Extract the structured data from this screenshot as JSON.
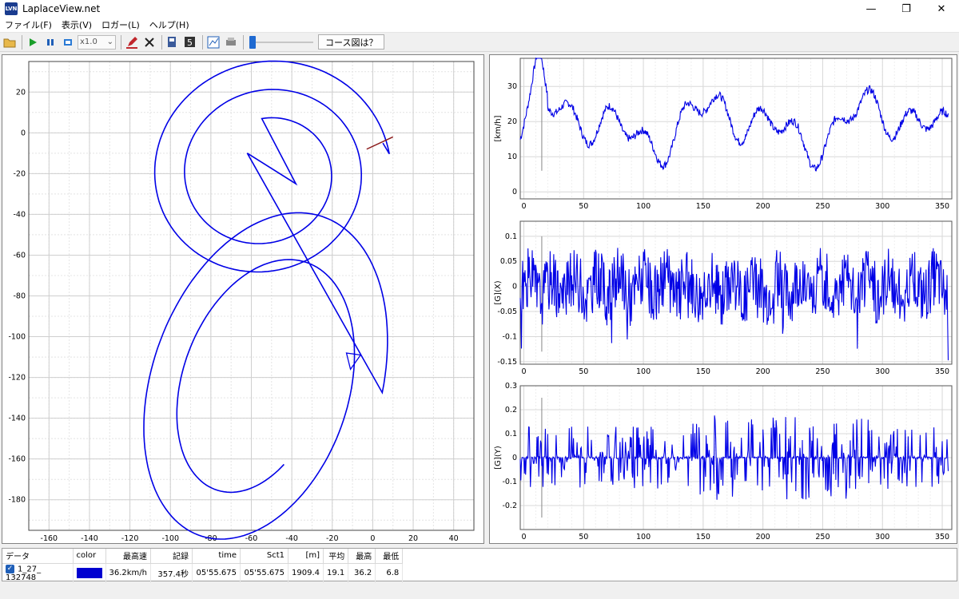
{
  "window": {
    "title": "LaplaceView.net",
    "icon": "LVN",
    "min": "—",
    "max": "❐",
    "close": "✕"
  },
  "menu": [
    "ファイル(F)",
    "表示(V)",
    "ロガー(L)",
    "ヘルプ(H)"
  ],
  "toolbar": {
    "speed": "x1.0",
    "course_button": "コース図は？",
    "slider_position": 0
  },
  "colors": {
    "trace": "#0000e6",
    "accent": "#1f6ad1",
    "marker": "#8b1a1a"
  },
  "track_plot": {
    "x_ticks": [
      "-160",
      "-140",
      "-120",
      "-100",
      "-80",
      "-60",
      "-40",
      "-20",
      "0",
      "20",
      "40"
    ],
    "y_ticks": [
      "20",
      "0",
      "-20",
      "-40",
      "-60",
      "-80",
      "-100",
      "-120",
      "-140",
      "-160",
      "-180"
    ]
  },
  "speed_chart": {
    "ylabel": "[km/h]",
    "y_ticks": [
      "0",
      "10",
      "20",
      "30"
    ],
    "x_ticks": [
      "0",
      "50",
      "100",
      "150",
      "200",
      "250",
      "300",
      "350"
    ]
  },
  "gx_chart": {
    "ylabel": "[G](X)",
    "y_ticks": [
      "-0.15",
      "-0.1",
      "-0.05",
      "0",
      "0.05",
      "0.1"
    ],
    "x_ticks": [
      "0",
      "50",
      "100",
      "150",
      "200",
      "250",
      "300",
      "350"
    ]
  },
  "gy_chart": {
    "ylabel": "[G](Y)",
    "y_ticks": [
      "-0.2",
      "-0.1",
      "0",
      "0.1",
      "0.2",
      "0.3"
    ],
    "x_ticks": [
      "0",
      "50",
      "100",
      "150",
      "200",
      "250",
      "300",
      "350"
    ]
  },
  "table": {
    "headers": [
      "データ",
      "color",
      "最高速",
      "記録",
      "time",
      "Sct1",
      "[m]",
      "平均",
      "最高",
      "最低"
    ],
    "row": {
      "checked": "✓",
      "name": "1_27_ 132748",
      "color": "#0000d0",
      "max_speed": "36.2km/h",
      "record": "357.4秒",
      "time": "05'55.675",
      "sct1": "05'55.675",
      "distance": "1909.4",
      "avg": "19.1",
      "max": "36.2",
      "min": "6.8"
    }
  }
}
